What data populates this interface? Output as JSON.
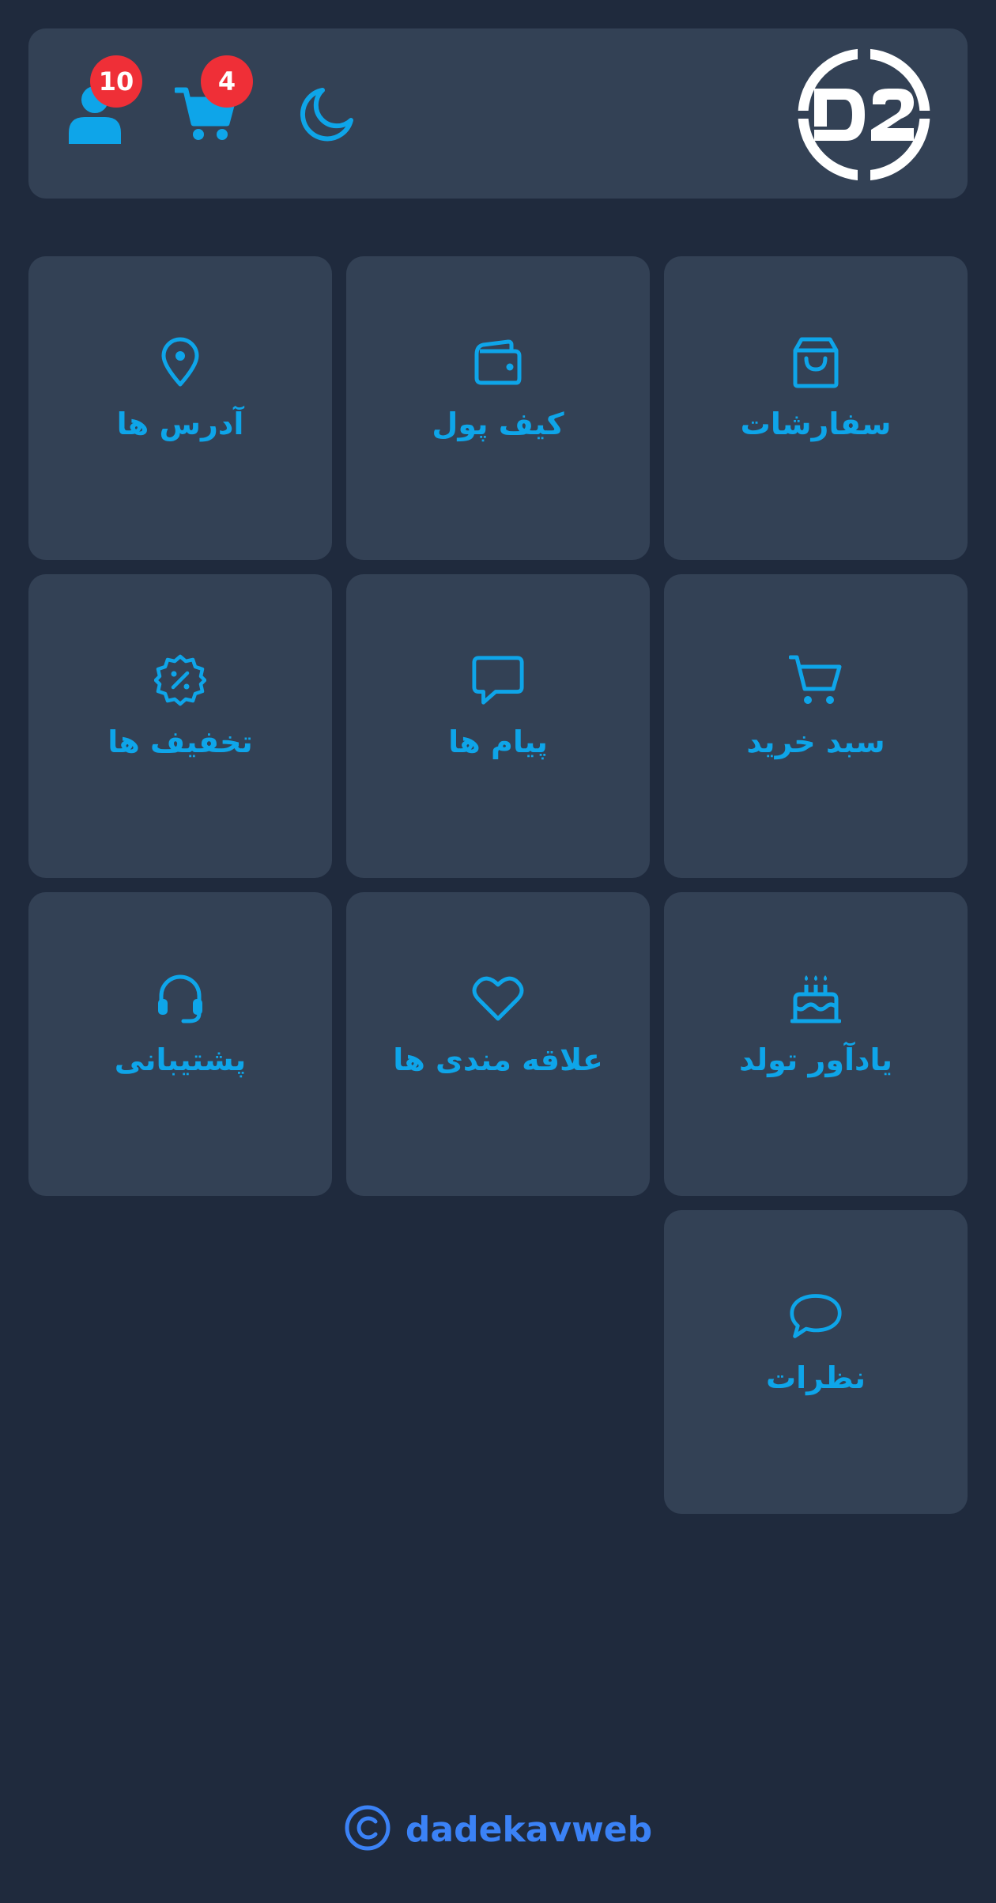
{
  "colors": {
    "page_bg": "#1f2a3d",
    "card_bg": "#334155",
    "accent": "#0ea5e9",
    "badge_bg": "#ef2f37",
    "footer_brand": "#3b82f6",
    "logo": "#ffffff"
  },
  "header": {
    "logo_icon": "d2-logo-icon",
    "user": {
      "icon": "user-icon",
      "badge": "10"
    },
    "cart": {
      "icon": "cart-icon",
      "badge": "4"
    },
    "theme_toggle": {
      "icon": "moon-icon"
    }
  },
  "menu": {
    "items": [
      {
        "label": "سفارشات",
        "icon": "shopping-bag-icon"
      },
      {
        "label": "کیف پول",
        "icon": "wallet-icon"
      },
      {
        "label": "آدرس ها",
        "icon": "map-pin-icon"
      },
      {
        "label": "سبد خرید",
        "icon": "cart-outline-icon"
      },
      {
        "label": "پیام ها",
        "icon": "message-square-icon"
      },
      {
        "label": "تخفیف ها",
        "icon": "discount-badge-icon"
      },
      {
        "label": "یادآور تولد",
        "icon": "cake-icon"
      },
      {
        "label": "علاقه مندی ها",
        "icon": "heart-icon"
      },
      {
        "label": "پشتیبانی",
        "icon": "headset-icon"
      },
      {
        "label": "نظرات",
        "icon": "comment-icon"
      }
    ]
  },
  "footer": {
    "icon": "copyright-icon",
    "brand": "dadekavweb"
  }
}
